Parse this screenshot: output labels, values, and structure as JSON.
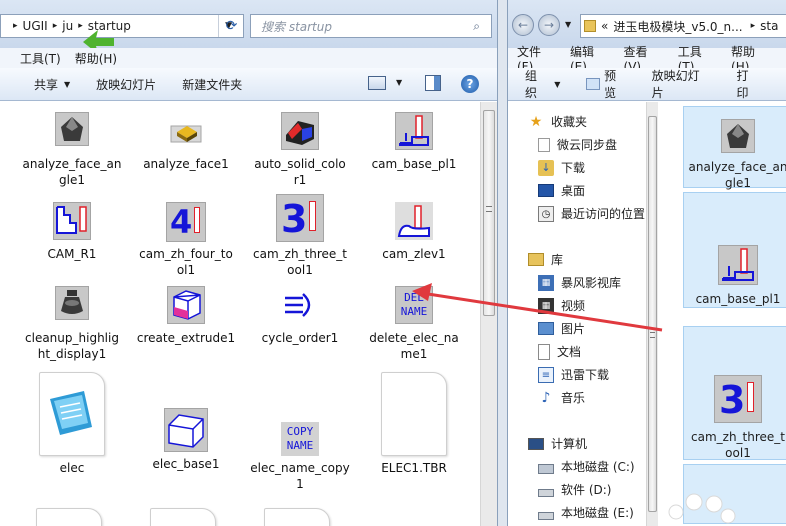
{
  "left": {
    "address": [
      "UGII",
      "ju",
      "startup"
    ],
    "search_placeholder": "搜索 startup",
    "menu": [
      "工具(T)",
      "帮助(H)"
    ],
    "toolbar": [
      "共享",
      "放映幻灯片",
      "新建文件夹"
    ],
    "items": [
      {
        "label": "analyze_face_angle1",
        "lines": [
          "analyze_face_an",
          "gle1"
        ]
      },
      {
        "label": "analyze_face1",
        "lines": [
          "analyze_face1"
        ]
      },
      {
        "label": "auto_solid_color1",
        "lines": [
          "auto_solid_colo",
          "r1"
        ]
      },
      {
        "label": "cam_base_pl1",
        "lines": [
          "cam_base_pl1"
        ]
      },
      {
        "label": "CAM_R1",
        "lines": [
          "CAM_R1"
        ]
      },
      {
        "label": "cam_zh_four_tool1",
        "lines": [
          "cam_zh_four_to",
          "ol1"
        ]
      },
      {
        "label": "cam_zh_three_tool1",
        "lines": [
          "cam_zh_three_t",
          "ool1"
        ]
      },
      {
        "label": "cam_zlev1",
        "lines": [
          "cam_zlev1"
        ]
      },
      {
        "label": "cleanup_highlight_display1",
        "lines": [
          "cleanup_highlig",
          "ht_display1"
        ]
      },
      {
        "label": "create_extrude1",
        "lines": [
          "create_extrude1"
        ]
      },
      {
        "label": "cycle_order1",
        "lines": [
          "cycle_order1"
        ]
      },
      {
        "label": "delete_elec_name1",
        "lines": [
          "delete_elec_na",
          "me1"
        ]
      },
      {
        "label": "elec",
        "lines": [
          "elec"
        ]
      },
      {
        "label": "elec_base1",
        "lines": [
          "elec_base1"
        ]
      },
      {
        "label": "elec_name_copy1",
        "lines": [
          "elec_name_copy",
          "1"
        ]
      },
      {
        "label": "ELEC1.TBR",
        "lines": [
          "ELEC1.TBR"
        ]
      }
    ],
    "icon_texts": {
      "four": "4",
      "three": "3",
      "del": "DEL",
      "name": "NAME",
      "copy": "COPY"
    }
  },
  "right": {
    "address": "进玉电极模块_v5.0_n...",
    "address_tail": "sta",
    "address_prefix": "«",
    "menu": [
      "文件(F)",
      "编辑(E)",
      "查看(V)",
      "工具(T)",
      "帮助(H)"
    ],
    "toolbar": [
      "组织",
      "预览",
      "放映幻灯片",
      "打印"
    ],
    "nav": [
      {
        "label": "收藏夹",
        "icon": "star-icon"
      },
      {
        "label": "微云同步盘",
        "icon": "cloud-icon"
      },
      {
        "label": "下载",
        "icon": "download-icon"
      },
      {
        "label": "桌面",
        "icon": "desktop-icon"
      },
      {
        "label": "最近访问的位置",
        "icon": "recent-icon"
      },
      {
        "label": "库",
        "icon": "library-icon"
      },
      {
        "label": "暴风影视库",
        "icon": "video-library-icon"
      },
      {
        "label": "视频",
        "icon": "video-icon"
      },
      {
        "label": "图片",
        "icon": "picture-icon"
      },
      {
        "label": "文档",
        "icon": "document-icon"
      },
      {
        "label": "迅雷下载",
        "icon": "thunder-download-icon"
      },
      {
        "label": "音乐",
        "icon": "music-icon"
      },
      {
        "label": "计算机",
        "icon": "computer-icon"
      },
      {
        "label": "本地磁盘 (C:)",
        "icon": "drive-c-icon"
      },
      {
        "label": "软件 (D:)",
        "icon": "drive-d-icon"
      },
      {
        "label": "本地磁盘 (E:)",
        "icon": "drive-e-icon"
      }
    ],
    "items": [
      {
        "label": "analyze_face_angle1",
        "lines": [
          "analyze_face_an",
          "gle1"
        ]
      },
      {
        "label": "cam_base_pl1",
        "lines": [
          "cam_base_pl1"
        ]
      },
      {
        "label": "cam_zh_three_tool1",
        "lines": [
          "cam_zh_three_t",
          "ool1"
        ]
      }
    ]
  },
  "colors": {
    "arrow": "#e0393e",
    "green_arrow": "#4fb32f",
    "icon_blue": "#1515d8",
    "icon_red": "#e0202a",
    "icon_gray": "#c8c8c8"
  }
}
